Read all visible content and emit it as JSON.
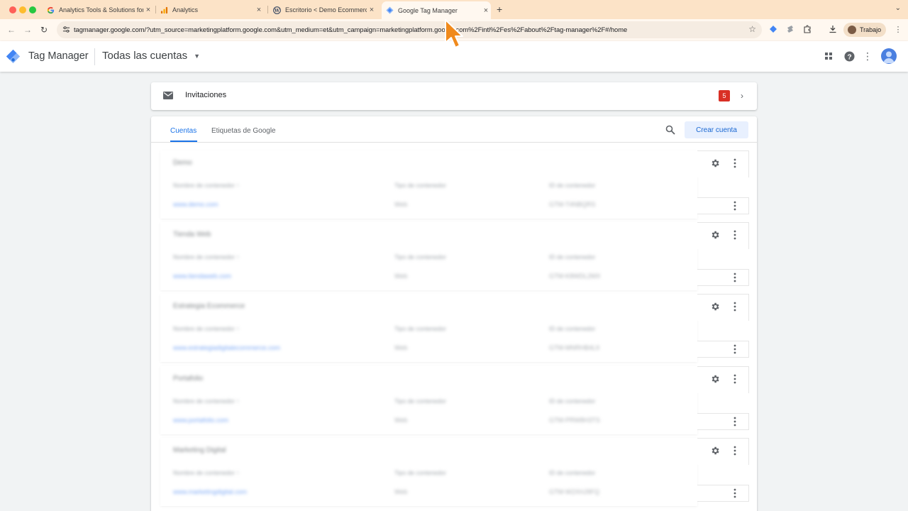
{
  "browser": {
    "tabs": [
      {
        "title": "Analytics Tools & Solutions for",
        "favicon": "google-g-icon",
        "active": false
      },
      {
        "title": "Analytics",
        "favicon": "analytics-bars-icon",
        "active": false
      },
      {
        "title": "Escritorio < Demo Ecommerce",
        "favicon": "wordpress-icon",
        "active": false
      },
      {
        "title": "Google Tag Manager",
        "favicon": "gtm-diamond-icon",
        "active": true
      }
    ],
    "new_tab": "+",
    "url": "tagmanager.google.com/?utm_source=marketingplatform.google.com&utm_medium=et&utm_campaign=marketingplatform.google.com%2Fintl%2Fes%2Fabout%2Ftag-manager%2F#/home",
    "profile_label": "Trabajo",
    "tab_bar_color": "#fce3c7"
  },
  "header": {
    "product_name": "Tag Manager",
    "account_selector": "Todas las cuentas"
  },
  "invitations": {
    "label": "Invitaciones",
    "count": "5",
    "badge_color": "#d93025"
  },
  "accounts_panel": {
    "tabs": [
      {
        "label": "Cuentas",
        "active": true
      },
      {
        "label": "Etiquetas de Google",
        "active": false
      }
    ],
    "create_label": "Crear cuenta",
    "accent_color": "#1a73e8",
    "accounts": [
      {
        "name": "Demo",
        "col1": "Nombre de contenedor ↑",
        "col2": "Tipo de contenedor",
        "col3": "ID de contenedor",
        "link": "www.demo.com",
        "type": "Web",
        "id": "GTM-T4NBQRS"
      },
      {
        "name": "Tienda Web",
        "col1": "Nombre de contenedor ↑",
        "col2": "Tipo de contenedor",
        "col3": "ID de contenedor",
        "link": "www.tiendaweb.com",
        "type": "Web",
        "id": "GTM-K8WDL2MX"
      },
      {
        "name": "Estrategia Ecommerce",
        "col1": "Nombre de contenedor ↑",
        "col2": "Tipo de contenedor",
        "col3": "ID de contenedor",
        "link": "www.estrategiadigitalecommerce.com",
        "type": "Web",
        "id": "GTM-MNRHB4L9"
      },
      {
        "name": "Portafolio",
        "col1": "Nombre de contenedor ↑",
        "col2": "Tipo de contenedor",
        "col3": "ID de contenedor",
        "link": "www.portafolio.com",
        "type": "Web",
        "id": "GTM-PRW8H3TS"
      },
      {
        "name": "Marketing Digital",
        "col1": "Nombre de contenedor ↑",
        "col2": "Tipo de contenedor",
        "col3": "ID de contenedor",
        "link": "www.marketingdigital.com",
        "type": "Web",
        "id": "GTM-W2XHJ9FQ"
      }
    ]
  }
}
